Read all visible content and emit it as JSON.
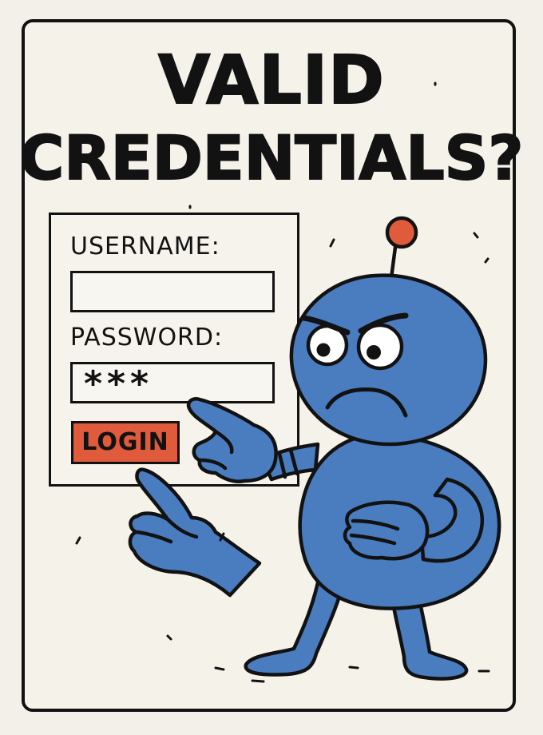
{
  "title": {
    "line1": "VALID",
    "line2": "CREDENTIALS?"
  },
  "login_form": {
    "username_label": "USERNAME:",
    "username_value": "",
    "password_label": "PASSWORD:",
    "password_value": "***",
    "login_button": "LOGIN"
  },
  "illustration": {
    "character": "angry blue robot pointing at login form",
    "accent_colors": {
      "robot_blue": "#4a7cc0",
      "antenna_red": "#e05a3c",
      "button_red": "#e05a3c",
      "ink": "#121212",
      "paper": "#f3f0e9"
    }
  }
}
